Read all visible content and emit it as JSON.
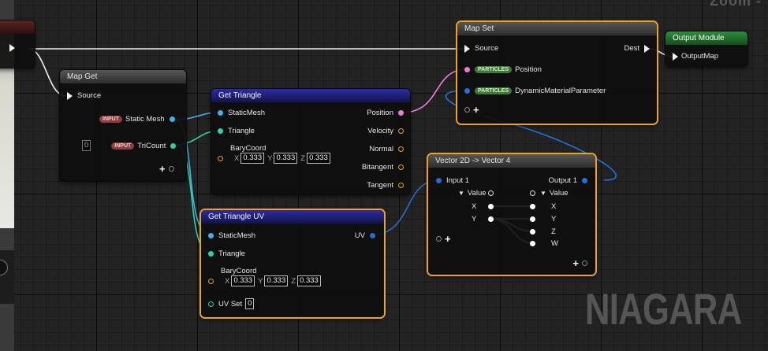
{
  "zoom_label": "Zoom -",
  "watermark": "NIAGARA",
  "colors": {
    "exec": "#ffffff",
    "mesh": "#3ab4ea",
    "int": "#32d0a6",
    "position": "#f07bd6",
    "vector": "#e3a419",
    "vec4": "#1f74d6",
    "vec2": "#2b6bd0",
    "orange_sel": "#f0a21a"
  },
  "nodes": {
    "map_get": {
      "title": "Map Get",
      "source": "Source",
      "static_mesh": "Static Mesh",
      "tricount": "TriCount",
      "tricount_value": "0",
      "input_badge": "INPUT"
    },
    "get_triangle": {
      "title": "Get Triangle",
      "static_mesh": "StaticMesh",
      "triangle": "Triangle",
      "barycoord": "BaryCoord",
      "x": "X",
      "y": "Y",
      "z": "Z",
      "x_val": "0.333",
      "y_val": "0.333",
      "z_val": "0.333",
      "outputs": [
        "Position",
        "Velocity",
        "Normal",
        "Bitangent",
        "Tangent"
      ]
    },
    "get_triangle_uv": {
      "title": "Get Triangle UV",
      "static_mesh": "StaticMesh",
      "triangle": "Triangle",
      "barycoord": "BaryCoord",
      "x": "X",
      "y": "Y",
      "z": "Z",
      "x_val": "0.333",
      "y_val": "0.333",
      "z_val": "0.333",
      "uv_set": "UV Set",
      "uv_set_val": "0",
      "uv_out": "UV"
    },
    "map_set": {
      "title": "Map Set",
      "source": "Source",
      "dest": "Dest",
      "particles_badge": "PARTICLES",
      "position": "Position",
      "dmp": "DynamicMaterialParameter"
    },
    "output_module": {
      "title": "Output Module",
      "output_map": "OutputMap"
    },
    "vec2_to_vec4": {
      "title": "Vector 2D -> Vector 4",
      "input1": "Input 1",
      "output1": "Output 1",
      "value_in": "Value",
      "value_out": "Value",
      "in_x": "X",
      "in_y": "Y",
      "out_x": "X",
      "out_y": "Y",
      "out_z": "Z",
      "out_w": "W"
    }
  }
}
